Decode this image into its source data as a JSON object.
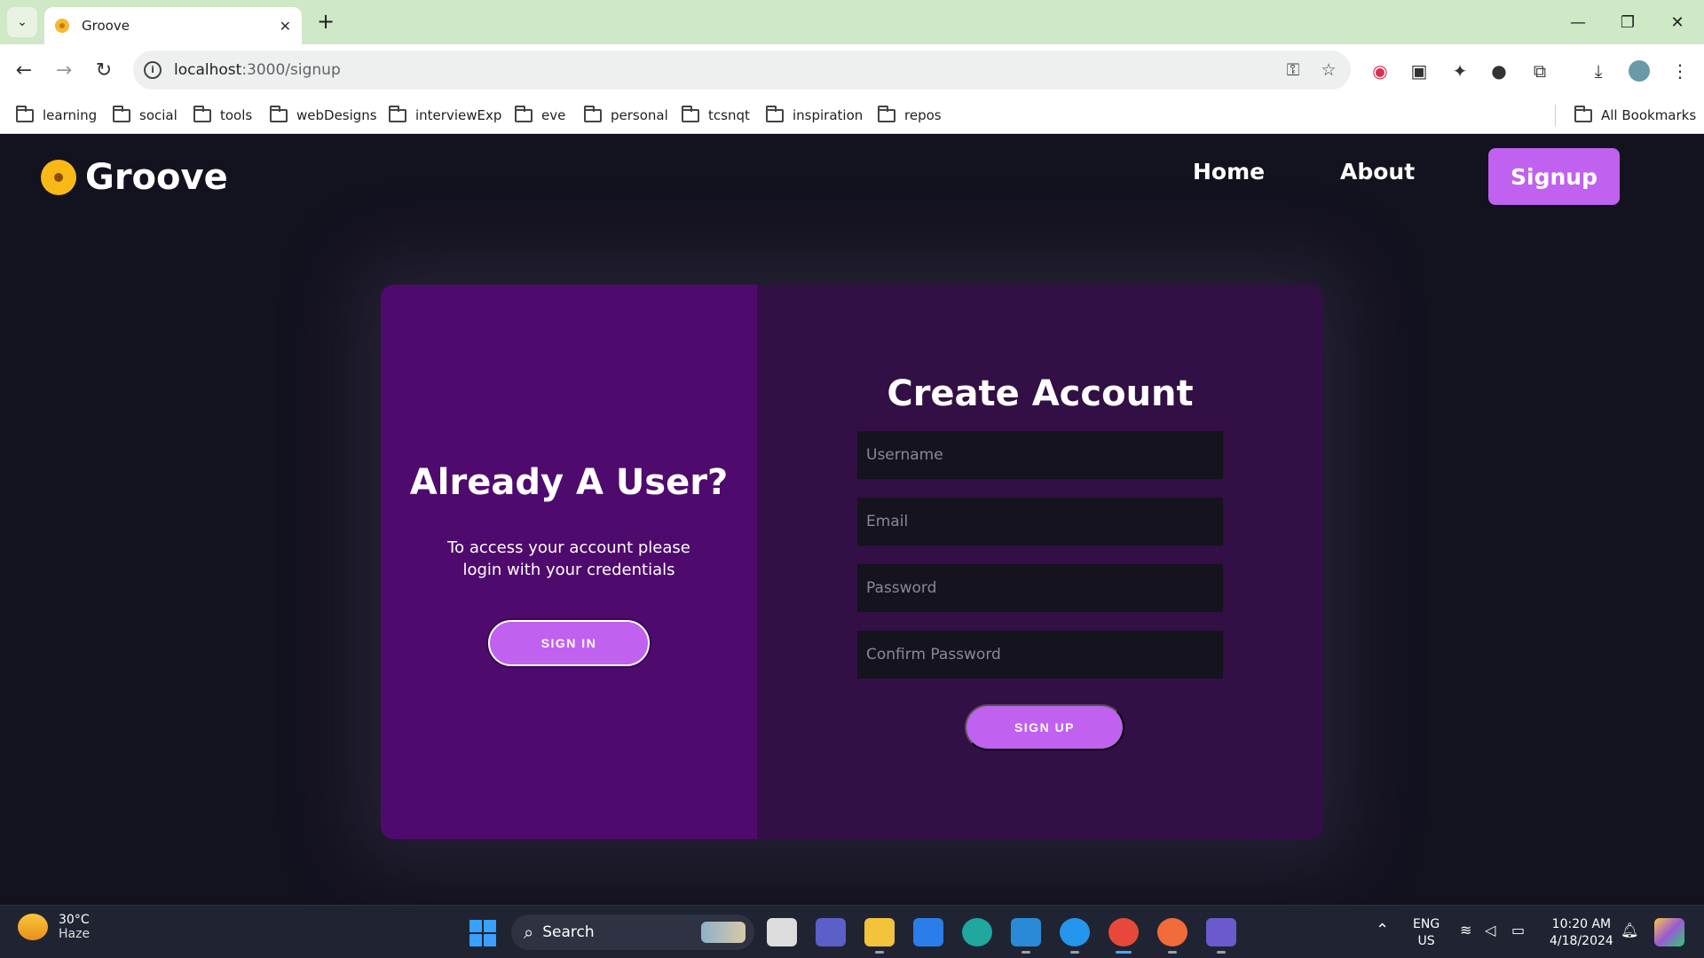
{
  "browser": {
    "tab_title": "Groove",
    "url_host": "localhost",
    "url_path": ":3000/signup",
    "bookmarks": [
      "learning",
      "social",
      "tools",
      "webDesigns",
      "interviewExp",
      "eve",
      "personal",
      "tcsnqt",
      "inspiration",
      "repos"
    ],
    "all_bookmarks": "All Bookmarks"
  },
  "site": {
    "brand": "Groove",
    "nav": {
      "home": "Home",
      "about": "About",
      "signup": "Signup"
    }
  },
  "signin_panel": {
    "title": "Already A User?",
    "text": "To access your account please login with your credentials",
    "button": "SIGN IN"
  },
  "signup_panel": {
    "title": "Create Account",
    "fields": {
      "username": "Username",
      "email": "Email",
      "password": "Password",
      "confirm": "Confirm Password"
    },
    "button": "SIGN UP"
  },
  "taskbar": {
    "temp": "30°C",
    "weather": "Haze",
    "search": "Search",
    "lang1": "ENG",
    "lang2": "US",
    "time": "10:20 AM",
    "date": "4/18/2024"
  },
  "colors": {
    "accent": "#c061f0",
    "left_panel": "#4f0a6e",
    "right_panel": "#320f45",
    "page_bg": "#13121f"
  }
}
